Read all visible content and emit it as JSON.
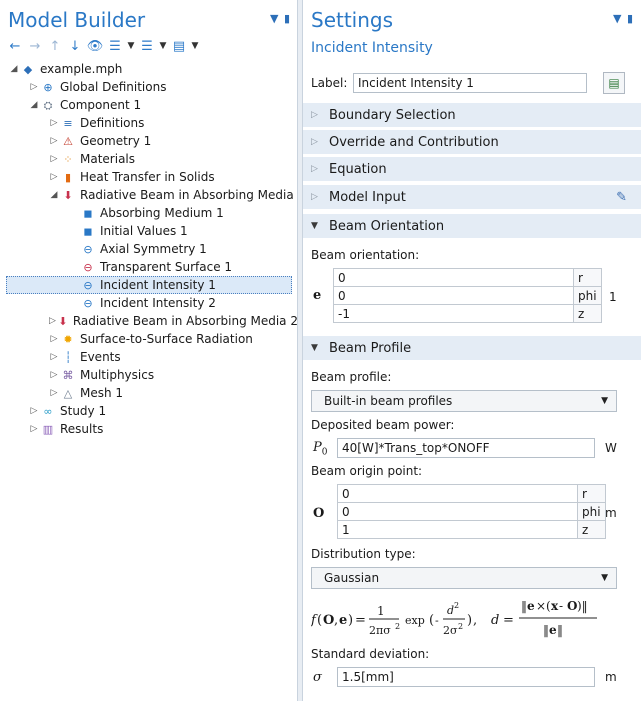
{
  "model_builder": {
    "title": "Model Builder",
    "tree": [
      {
        "label": "example.mph",
        "depth": 0,
        "caret": "open",
        "icon": "file-diamond-icon",
        "color": "#2d6fb8"
      },
      {
        "label": "Global Definitions",
        "depth": 1,
        "caret": "closed",
        "icon": "globe-icon",
        "color": "#2a78c6"
      },
      {
        "label": "Component 1",
        "depth": 1,
        "caret": "open",
        "icon": "component-icon",
        "color": "#6b7a8c"
      },
      {
        "label": "Definitions",
        "depth": 2,
        "caret": "closed",
        "icon": "definitions-icon",
        "color": "#2d6fb8"
      },
      {
        "label": "Geometry 1",
        "depth": 2,
        "caret": "closed",
        "icon": "geometry-icon",
        "color": "#c23a2a"
      },
      {
        "label": "Materials",
        "depth": 2,
        "caret": "closed",
        "icon": "materials-icon",
        "color": "#e08a1e"
      },
      {
        "label": "Heat Transfer in Solids",
        "depth": 2,
        "caret": "closed",
        "icon": "heat-transfer-icon",
        "color": "#e36b12"
      },
      {
        "label": "Radiative Beam in Absorbing Media",
        "depth": 2,
        "caret": "open",
        "icon": "radiative-beam-icon",
        "color": "#c8324d"
      },
      {
        "label": "Absorbing Medium 1",
        "depth": 3,
        "caret": "none",
        "icon": "domain-feature-icon",
        "color": "#2a78c6"
      },
      {
        "label": "Initial Values 1",
        "depth": 3,
        "caret": "none",
        "icon": "domain-feature-icon",
        "color": "#2a78c6"
      },
      {
        "label": "Axial Symmetry 1",
        "depth": 3,
        "caret": "none",
        "icon": "boundary-feature-icon",
        "color": "#2a78c6"
      },
      {
        "label": "Transparent Surface 1",
        "depth": 3,
        "caret": "none",
        "icon": "boundary-feature-icon",
        "color": "#c8324d"
      },
      {
        "label": "Incident Intensity 1",
        "depth": 3,
        "caret": "none",
        "icon": "boundary-feature-icon",
        "color": "#2a78c6",
        "selected": true
      },
      {
        "label": "Incident Intensity 2",
        "depth": 3,
        "caret": "none",
        "icon": "boundary-feature-icon",
        "color": "#2a78c6"
      },
      {
        "label": "Radiative Beam in Absorbing Media 2",
        "depth": 2,
        "caret": "closed",
        "icon": "radiative-beam-icon",
        "color": "#c8324d"
      },
      {
        "label": "Surface-to-Surface Radiation",
        "depth": 2,
        "caret": "closed",
        "icon": "sun-icon",
        "color": "#f0a500"
      },
      {
        "label": "Events",
        "depth": 2,
        "caret": "closed",
        "icon": "events-icon",
        "color": "#2a78c6"
      },
      {
        "label": "Multiphysics",
        "depth": 2,
        "caret": "closed",
        "icon": "multiphysics-icon",
        "color": "#7a5fa3"
      },
      {
        "label": "Mesh 1",
        "depth": 2,
        "caret": "closed",
        "icon": "mesh-icon",
        "color": "#6b7a8c"
      },
      {
        "label": "Study 1",
        "depth": 1,
        "caret": "closed",
        "icon": "study-icon",
        "color": "#2a9dc9"
      },
      {
        "label": "Results",
        "depth": 1,
        "caret": "closed",
        "icon": "results-icon",
        "color": "#8a5fb8"
      }
    ]
  },
  "settings": {
    "title": "Settings",
    "subtitle": "Incident Intensity",
    "label_caption": "Label:",
    "label_value": "Incident Intensity 1",
    "sections": {
      "boundary_selection": "Boundary Selection",
      "override": "Override and Contribution",
      "equation": "Equation",
      "model_input": "Model Input",
      "beam_orientation": "Beam Orientation",
      "beam_profile": "Beam Profile"
    },
    "beam_orientation": {
      "caption": "Beam orientation:",
      "symbol": "e",
      "unit": "1",
      "rows": [
        {
          "value": "0",
          "comp": "r"
        },
        {
          "value": "0",
          "comp": "phi"
        },
        {
          "value": "-1",
          "comp": "z"
        }
      ]
    },
    "beam_profile": {
      "caption": "Beam profile:",
      "selected": "Built-in beam profiles",
      "power_caption": "Deposited beam power:",
      "power_symbol": "P",
      "power_symbol_sub": "0",
      "power_value": "40[W]*Trans_top*ONOFF",
      "power_unit": "W",
      "origin_caption": "Beam origin point:",
      "origin_symbol": "O",
      "origin_unit": "m",
      "origin_rows": [
        {
          "value": "0",
          "comp": "r"
        },
        {
          "value": "0",
          "comp": "phi"
        },
        {
          "value": "1",
          "comp": "z"
        }
      ],
      "distribution_caption": "Distribution type:",
      "distribution_selected": "Gaussian",
      "std_caption": "Standard deviation:",
      "std_symbol": "σ",
      "std_value": "1.5[mm]",
      "std_unit": "m"
    }
  }
}
